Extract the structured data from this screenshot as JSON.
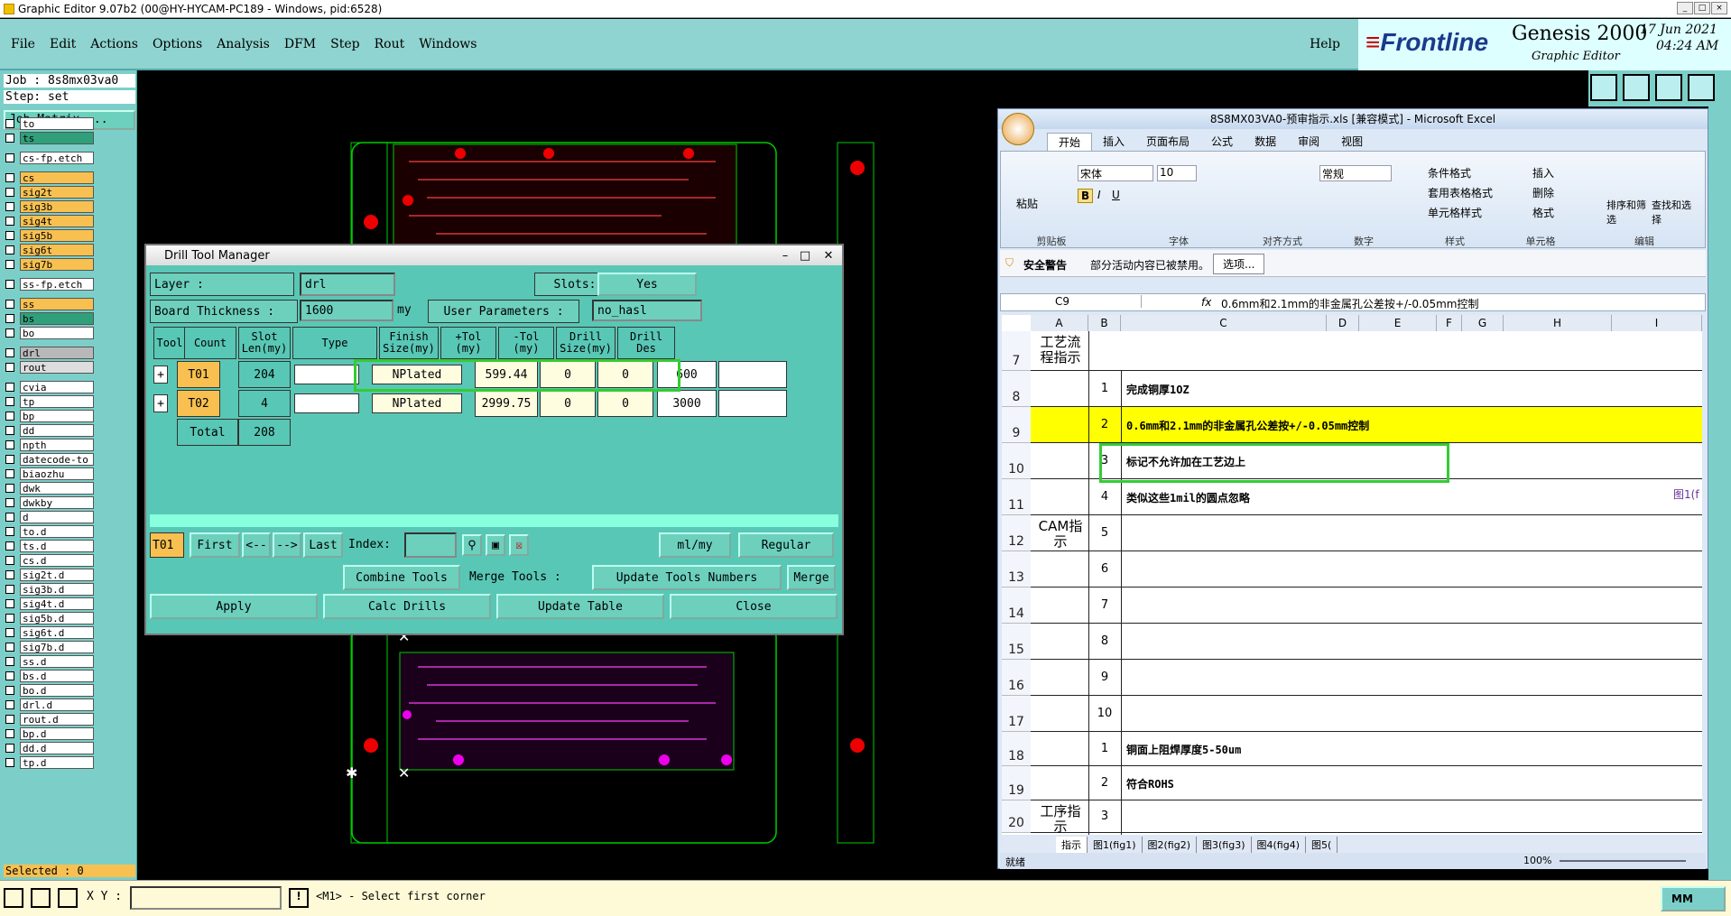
{
  "window": {
    "title": "Graphic Editor 9.07b2 (00@HY-HYCAM-PC189 - Windows, pid:6528)"
  },
  "menu": {
    "items": [
      "File",
      "Edit",
      "Actions",
      "Options",
      "Analysis",
      "DFM",
      "Step",
      "Rout",
      "Windows"
    ],
    "help": "Help"
  },
  "brand": {
    "logo": "Frontline",
    "product": "Genesis 2000",
    "subtitle": "Graphic Editor",
    "date": "17 Jun 2021",
    "time": "04:24 AM"
  },
  "left": {
    "job": "Job : 8s8mx03va0",
    "step": "Step: set",
    "matrix_btn": "Job Matrix ...",
    "selected": "Selected : 0",
    "layers": [
      {
        "name": "to",
        "color": "#ffffff"
      },
      {
        "name": "ts",
        "color": "#2fa07a"
      },
      {
        "name": "cs-fp.etch",
        "color": "#ffffff"
      },
      {
        "name": "cs",
        "color": "#f8c050"
      },
      {
        "name": "sig2t",
        "color": "#f8c050"
      },
      {
        "name": "sig3b",
        "color": "#f8c050"
      },
      {
        "name": "sig4t",
        "color": "#f8c050"
      },
      {
        "name": "sig5b",
        "color": "#f8c050"
      },
      {
        "name": "sig6t",
        "color": "#f8c050"
      },
      {
        "name": "sig7b",
        "color": "#f8c050"
      },
      {
        "name": "ss-fp.etch",
        "color": "#ffffff"
      },
      {
        "name": "ss",
        "color": "#f8c050"
      },
      {
        "name": "bs",
        "color": "#2fa07a"
      },
      {
        "name": "bo",
        "color": "#ffffff"
      },
      {
        "name": "drl",
        "color": "#b8b8b8"
      },
      {
        "name": "rout",
        "color": "#dddddd"
      },
      {
        "name": "cvia",
        "color": "#ffffff"
      },
      {
        "name": "tp",
        "color": "#ffffff"
      },
      {
        "name": "bp",
        "color": "#ffffff"
      },
      {
        "name": "dd",
        "color": "#ffffff"
      },
      {
        "name": "npth",
        "color": "#ffffff"
      },
      {
        "name": "datecode-to",
        "color": "#ffffff"
      },
      {
        "name": "biaozhu",
        "color": "#ffffff"
      },
      {
        "name": "dwk",
        "color": "#ffffff"
      },
      {
        "name": "dwkby",
        "color": "#ffffff"
      },
      {
        "name": "d",
        "color": "#ffffff"
      },
      {
        "name": "to.d",
        "color": "#ffffff"
      },
      {
        "name": "ts.d",
        "color": "#ffffff"
      },
      {
        "name": "cs.d",
        "color": "#ffffff"
      },
      {
        "name": "sig2t.d",
        "color": "#ffffff"
      },
      {
        "name": "sig3b.d",
        "color": "#ffffff"
      },
      {
        "name": "sig4t.d",
        "color": "#ffffff"
      },
      {
        "name": "sig5b.d",
        "color": "#ffffff"
      },
      {
        "name": "sig6t.d",
        "color": "#ffffff"
      },
      {
        "name": "sig7b.d",
        "color": "#ffffff"
      },
      {
        "name": "ss.d",
        "color": "#ffffff"
      },
      {
        "name": "bs.d",
        "color": "#ffffff"
      },
      {
        "name": "bo.d",
        "color": "#ffffff"
      },
      {
        "name": "drl.d",
        "color": "#ffffff"
      },
      {
        "name": "rout.d",
        "color": "#ffffff"
      },
      {
        "name": "bp.d",
        "color": "#ffffff"
      },
      {
        "name": "dd.d",
        "color": "#ffffff"
      },
      {
        "name": "tp.d",
        "color": "#ffffff"
      }
    ]
  },
  "drill": {
    "title": "Drill Tool Manager",
    "layer_label": "Layer :",
    "layer_value": "drl",
    "slots_label": "Slots:",
    "slots_value": "Yes",
    "thickness_label": "Board Thickness :",
    "thickness_value": "1600",
    "thickness_unit": "my",
    "user_params_label": "User Parameters :",
    "user_params_value": "no_hasl",
    "headers": [
      "Tool",
      "Count",
      "Slot Len(my)",
      "Type",
      "Finish Size(my)",
      "+Tol (my)",
      "-Tol (my)",
      "Drill Size(my)",
      "Drill Des"
    ],
    "rows": [
      {
        "tool": "T01",
        "count": "204",
        "type": "NPlated",
        "finish": "599.44",
        "ptol": "0",
        "mtol": "0",
        "drill": "600"
      },
      {
        "tool": "T02",
        "count": "4",
        "type": "NPlated",
        "finish": "2999.75",
        "ptol": "0",
        "mtol": "0",
        "drill": "3000"
      }
    ],
    "total_label": "Total",
    "total_value": "208",
    "current_tool": "T01",
    "first": "First",
    "prev": "<--",
    "next": "-->",
    "last": "Last",
    "index_label": "Index:",
    "units": "ml/my",
    "mode": "Regular",
    "combine": "Combine Tools",
    "merge_label": "Merge Tools :",
    "update_numbers": "Update Tools Numbers",
    "merge": "Merge",
    "apply": "Apply",
    "calc": "Calc Drills",
    "update_table": "Update Table",
    "close": "Close"
  },
  "excel": {
    "title": "8S8MX03VA0-预审指示.xls  [兼容模式] - Microsoft Excel",
    "tabs": [
      "开始",
      "插入",
      "页面布局",
      "公式",
      "数据",
      "审阅",
      "视图"
    ],
    "font": "宋体",
    "size": "10",
    "numfmt": "常规",
    "styles": [
      "条件格式",
      "套用表格格式",
      "单元格样式"
    ],
    "cells_ops": [
      "插入",
      "删除",
      "格式"
    ],
    "edit_ops": [
      "排序和筛选",
      "查找和选择"
    ],
    "groups": [
      "剪贴板",
      "字体",
      "对齐方式",
      "数字",
      "样式",
      "单元格",
      "编辑"
    ],
    "paste": "粘贴",
    "security": "安全警告",
    "security_msg": "部分活动内容已被禁用。",
    "options_btn": "选项...",
    "namebox": "C9",
    "formula": "0.6mm和2.1mm的非金属孔公差按+/-0.05mm控制",
    "cols": [
      "A",
      "B",
      "C",
      "D",
      "E",
      "F",
      "G",
      "H",
      "I"
    ],
    "rows": [
      {
        "r": "7",
        "a": "工艺流程指示",
        "b": "",
        "c": ""
      },
      {
        "r": "8",
        "a": "",
        "b": "1",
        "c": "完成铜厚1OZ"
      },
      {
        "r": "9",
        "a": "",
        "b": "2",
        "c": "0.6mm和2.1mm的非金属孔公差按+/-0.05mm控制"
      },
      {
        "r": "10",
        "a": "",
        "b": "3",
        "c": "标记不允许加在工艺边上"
      },
      {
        "r": "11",
        "a": "",
        "b": "4",
        "c": "类似这些1mil的圆点忽略"
      },
      {
        "r": "12",
        "a": "CAM指示",
        "b": "5",
        "c": ""
      },
      {
        "r": "13",
        "a": "",
        "b": "6",
        "c": ""
      },
      {
        "r": "14",
        "a": "",
        "b": "7",
        "c": ""
      },
      {
        "r": "15",
        "a": "",
        "b": "8",
        "c": ""
      },
      {
        "r": "16",
        "a": "",
        "b": "9",
        "c": ""
      },
      {
        "r": "17",
        "a": "",
        "b": "10",
        "c": ""
      },
      {
        "r": "18",
        "a": "",
        "b": "1",
        "c": "铜面上阻焊厚度5-50um"
      },
      {
        "r": "19",
        "a": "",
        "b": "2",
        "c": "符合ROHS"
      },
      {
        "r": "20",
        "a": "工序指示",
        "b": "3",
        "c": ""
      }
    ],
    "sheet_tabs": [
      "指示",
      "图1(fig1)",
      "图2(fig2)",
      "图3(fig3)",
      "图4(fig4)",
      "图5("
    ],
    "status": "就绪",
    "zoom": "100%",
    "i_col_text": "图1(f"
  },
  "status": {
    "xy_label": "X Y :",
    "message": "<M1> - Select first corner",
    "mode": "MM"
  }
}
